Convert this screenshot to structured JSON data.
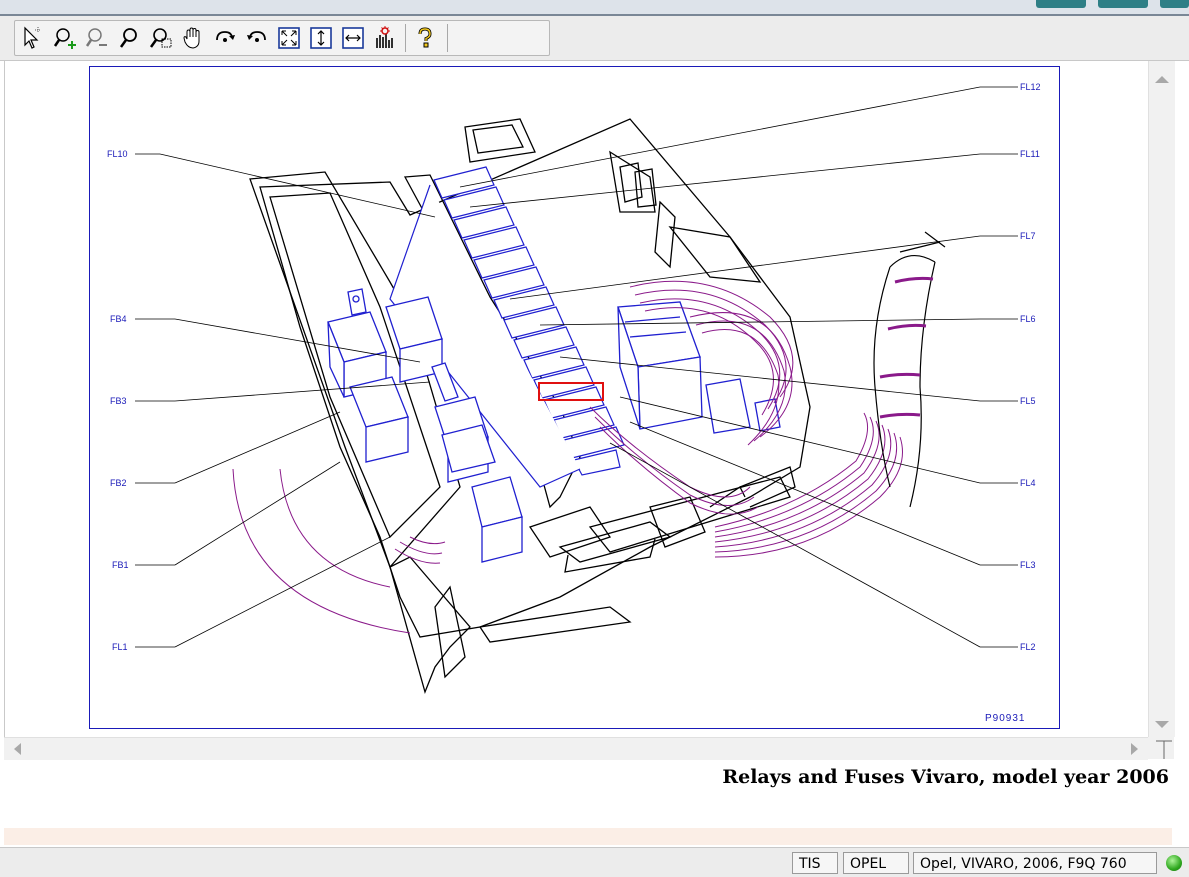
{
  "toolbar": {
    "tools": [
      {
        "name": "select-pointer-icon"
      },
      {
        "name": "zoom-in-icon"
      },
      {
        "name": "zoom-out-icon"
      },
      {
        "name": "zoom-icon"
      },
      {
        "name": "zoom-window-icon"
      },
      {
        "name": "pan-hand-icon"
      },
      {
        "name": "rotate-right-icon"
      },
      {
        "name": "rotate-left-icon"
      },
      {
        "name": "fit-page-icon"
      },
      {
        "name": "fit-height-icon"
      },
      {
        "name": "fit-width-icon"
      },
      {
        "name": "highlight-icon"
      },
      {
        "name": "help-icon"
      }
    ]
  },
  "diagram": {
    "ref_code": "P90931",
    "labels": {
      "fl10": "FL10",
      "fb4": "FB4",
      "fb3": "FB3",
      "fb2": "FB2",
      "fb1": "FB1",
      "fl1": "FL1",
      "fl12": "FL12",
      "fl11": "FL11",
      "fl7": "FL7",
      "fl6": "FL6",
      "fl5": "FL5",
      "fl4": "FL4",
      "fl3": "FL3",
      "fl2": "FL2"
    },
    "colors": {
      "frame": "#1a1ab8",
      "label": "#1a1ab8",
      "relay": "#2020d0",
      "harness": "#8a1a8a",
      "highlight": "#e01010",
      "line": "#000000"
    }
  },
  "caption": "Relays and Fuses Vivaro, model year 2006",
  "status": {
    "app": "TIS",
    "brand": "OPEL",
    "vehicle": "Opel, VIVARO, 2006, F9Q 760",
    "indicator_color": "#2fa81f"
  }
}
